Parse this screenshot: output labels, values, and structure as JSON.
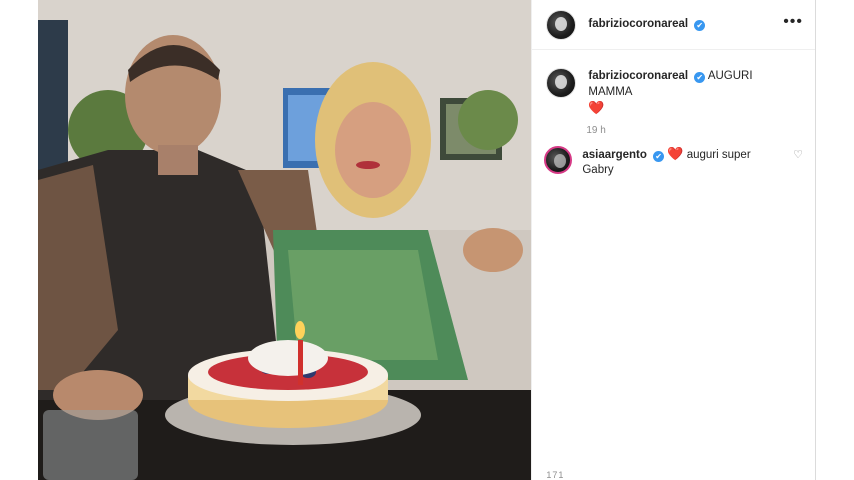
{
  "post": {
    "username": "fabriziocoronareal",
    "verified_mark": "✔",
    "more_label": "•••",
    "caption_text": "AUGURI MAMMA",
    "caption_emoji": "❤️",
    "time": "19 h",
    "comments": [
      {
        "username": "asiaargento",
        "heart": "❤️",
        "text": "auguri super Gabry",
        "like_icon": "♡"
      }
    ],
    "footer_partial": "171"
  },
  "colors": {
    "verified_blue": "#3897f0",
    "heart_red": "#ed4956",
    "meta_gray": "#8e8e8e"
  },
  "icons": [
    "verified-badge-icon",
    "more-options-icon",
    "heart-outline-icon"
  ]
}
